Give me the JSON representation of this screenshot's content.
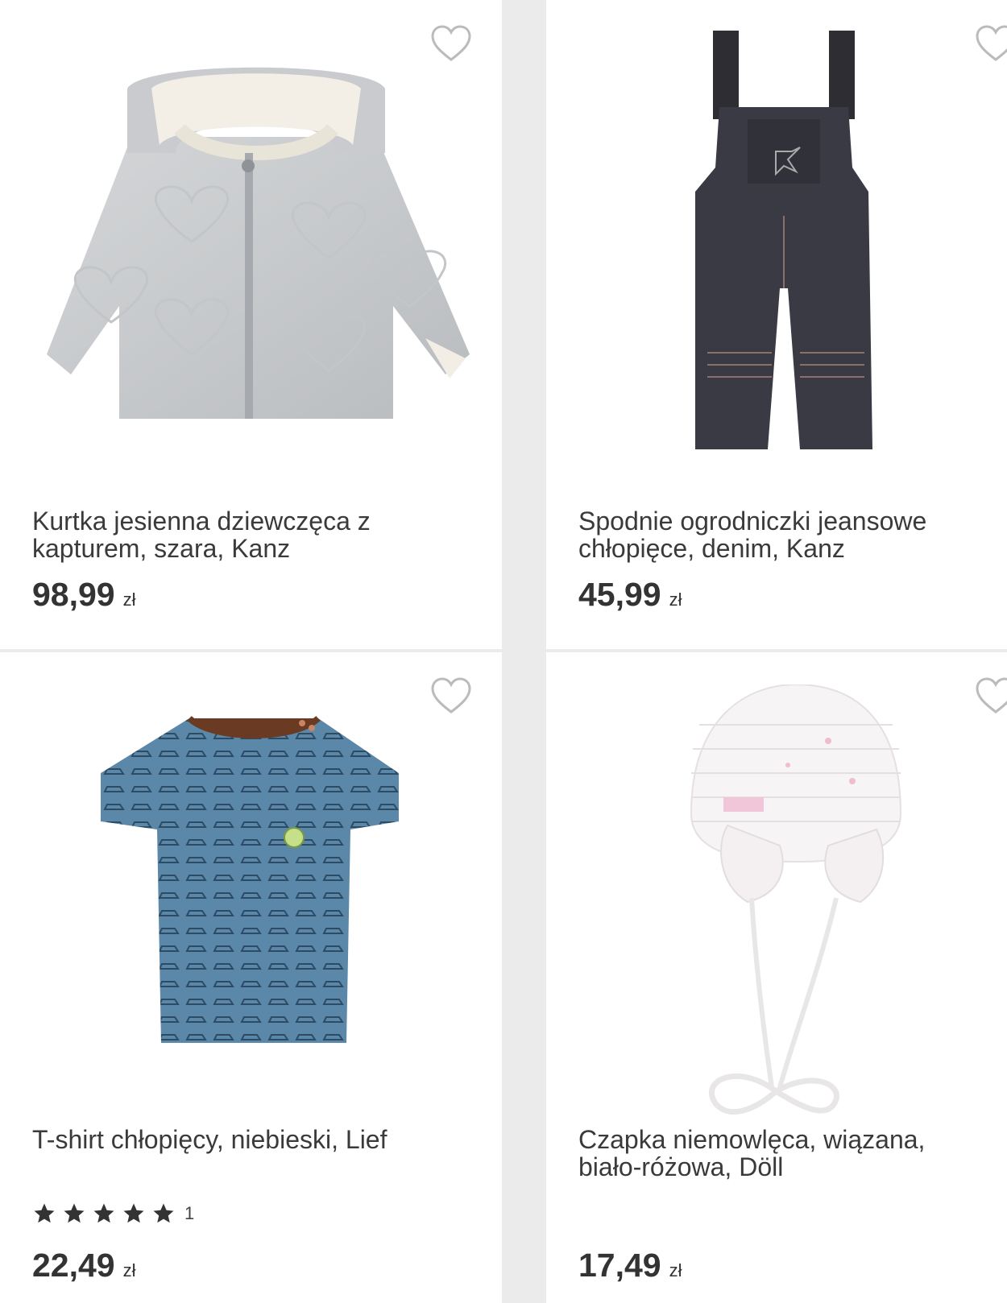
{
  "products": [
    {
      "title": "Kurtka jesienna dziewczęca z kapturem, szara, Kanz",
      "price": "98,99",
      "currency": "zł",
      "image_icon": "grey-quilted-jacket-image"
    },
    {
      "title": "Spodnie ogrodniczki jeansowe chłopięce, denim, Kanz",
      "price": "45,99",
      "currency": "zł",
      "image_icon": "denim-overalls-image"
    },
    {
      "title": "T-shirt chłopięcy, niebieski, Lief",
      "price": "22,49",
      "currency": "zł",
      "rating": 5,
      "review_count": "1",
      "image_icon": "blue-car-print-tshirt-image"
    },
    {
      "title": "Czapka niemowlęca, wiązana, biało-różowa, Döll",
      "price": "17,49",
      "currency": "zł",
      "image_icon": "white-pink-baby-hat-image"
    }
  ],
  "colors": {
    "text": "#3a3a3a",
    "star": "#333333",
    "heart_outline": "#bbbbbb",
    "background": "#ebebeb"
  }
}
